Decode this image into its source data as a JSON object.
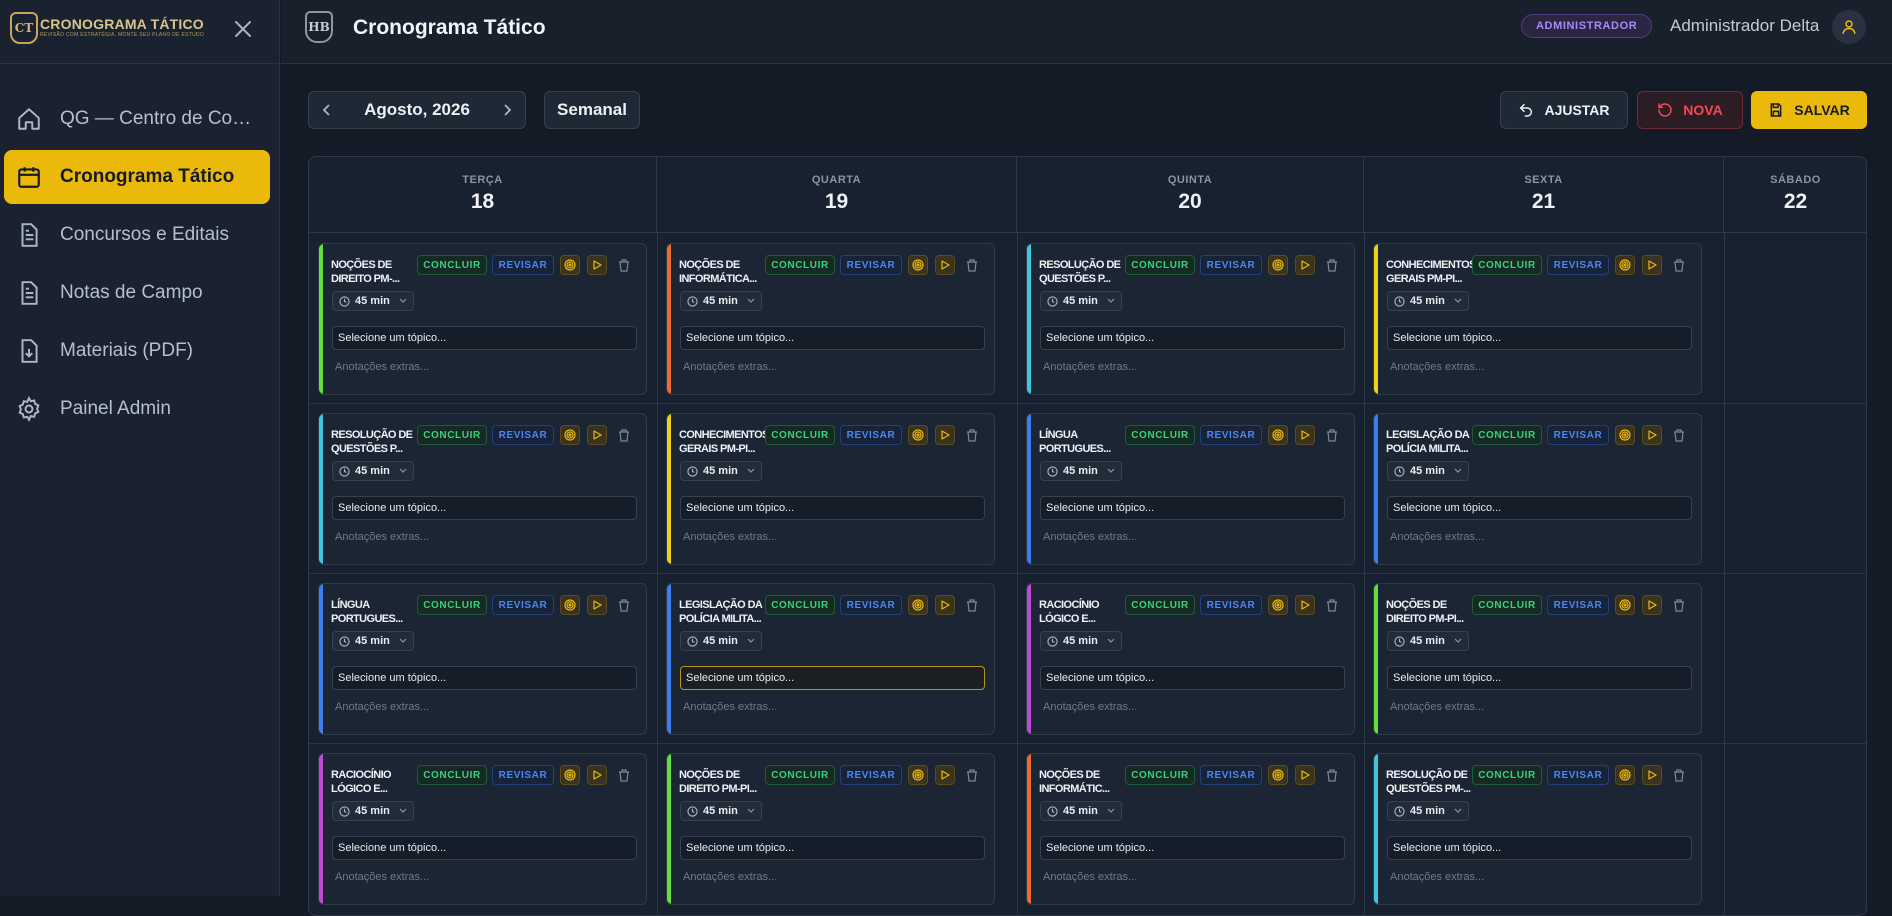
{
  "sidebar": {
    "logo_text": "CT",
    "app_title": "CRONOGRAMA TÁTICO",
    "tagline": "REVISÃO COM ESTRATÉGIA, MONTE SEU PLANO DE ESTUDO",
    "items": [
      {
        "label": "QG — Centro de Comando",
        "icon": "home-icon",
        "active": false
      },
      {
        "label": "Cronograma Tático",
        "icon": "calendar-icon",
        "active": true
      },
      {
        "label": "Concursos e Editais",
        "icon": "document-icon",
        "active": false
      },
      {
        "label": "Notas de Campo",
        "icon": "document-icon",
        "active": false
      },
      {
        "label": "Materiais (PDF)",
        "icon": "file-download-icon",
        "active": false
      },
      {
        "label": "Painel Admin",
        "icon": "gear-icon",
        "active": false
      }
    ]
  },
  "header": {
    "logo_text": "HB",
    "title": "Cronograma Tático",
    "role_badge": "ADMINISTRADOR",
    "user_name": "Administrador Delta"
  },
  "toolbar": {
    "month_label": "Agosto, 2026",
    "view_label": "Semanal",
    "ajustar_label": "AJUSTAR",
    "nova_label": "NOVA",
    "salvar_label": "SALVAR"
  },
  "colors": {
    "accent": "#ebb90a",
    "orange": "#f06a2b",
    "cyan": "#3fc6dc",
    "yellow": "#ead21a",
    "blue": "#3e7df0",
    "purple": "#c04ad6",
    "green": "#5fe03a"
  },
  "card_labels": {
    "concluir": "CONCLUIR",
    "revisar": "REVISAR",
    "topic_placeholder": "Selecione um tópico...",
    "notes_placeholder": "Anotações extras..."
  },
  "days": [
    {
      "dow": "TERÇA",
      "num": "18",
      "blocks": [
        {
          "title": "NOÇÕES DE DIREITO PM-...",
          "duration": "45 min",
          "color": "green"
        },
        {
          "title": "RESOLUÇÃO DE QUESTÕES P...",
          "duration": "45 min",
          "color": "cyan"
        },
        {
          "title": "LÍNGUA PORTUGUES...",
          "duration": "45 min",
          "color": "blue"
        },
        {
          "title": "RACIOCÍNIO LÓGICO E...",
          "duration": "45 min",
          "color": "purple"
        }
      ]
    },
    {
      "dow": "QUARTA",
      "num": "19",
      "blocks": [
        {
          "title": "NOÇÕES DE INFORMÁTICA...",
          "duration": "45 min",
          "color": "orange"
        },
        {
          "title": "CONHECIMENTOS GERAIS PM-PI...",
          "duration": "45 min",
          "color": "yellow"
        },
        {
          "title": "LEGISLAÇÃO DA POLÍCIA MILITA...",
          "duration": "45 min",
          "color": "blue",
          "focused": true
        },
        {
          "title": "NOÇÕES DE DIREITO PM-PI...",
          "duration": "45 min",
          "color": "green"
        }
      ]
    },
    {
      "dow": "QUINTA",
      "num": "20",
      "blocks": [
        {
          "title": "RESOLUÇÃO DE QUESTÕES P...",
          "duration": "45 min",
          "color": "cyan"
        },
        {
          "title": "LÍNGUA PORTUGUES...",
          "duration": "45 min",
          "color": "blue"
        },
        {
          "title": "RACIOCÍNIO LÓGICO E...",
          "duration": "45 min",
          "color": "purple"
        },
        {
          "title": "NOÇÕES DE INFORMÁTIC...",
          "duration": "45 min",
          "color": "orange"
        }
      ]
    },
    {
      "dow": "SEXTA",
      "num": "21",
      "blocks": [
        {
          "title": "CONHECIMENTOS GERAIS PM-PI...",
          "duration": "45 min",
          "color": "yellow"
        },
        {
          "title": "LEGISLAÇÃO DA POLÍCIA MILITA...",
          "duration": "45 min",
          "color": "blue"
        },
        {
          "title": "NOÇÕES DE DIREITO PM-PI...",
          "duration": "45 min",
          "color": "green"
        },
        {
          "title": "RESOLUÇÃO DE QUESTÕES PM-...",
          "duration": "45 min",
          "color": "cyan"
        }
      ]
    },
    {
      "dow": "SÁBADO",
      "num": "22",
      "blocks": []
    }
  ]
}
